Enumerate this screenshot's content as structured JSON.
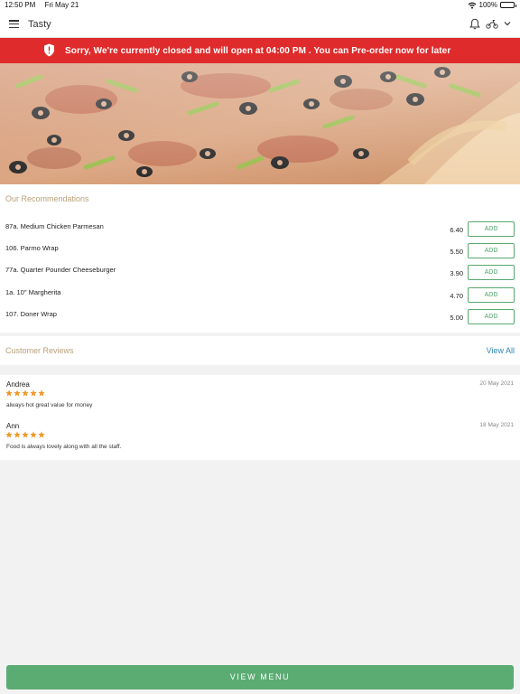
{
  "status_bar": {
    "time": "12:50 PM",
    "date": "Fri May 21",
    "battery": "100%"
  },
  "header": {
    "title": "Tasty"
  },
  "banner": {
    "message": "Sorry, We're currently closed and will open at 04:00 PM . You can Pre-order now for later",
    "color": "#df2b2b"
  },
  "recommendations": {
    "title": "Our Recommendations",
    "add_label": "ADD",
    "items": [
      {
        "name": "87a. Medium Chicken Parmesan",
        "price": "6.40"
      },
      {
        "name": "106. Parmo Wrap",
        "price": "5.50"
      },
      {
        "name": "77a. Quarter Pounder Cheeseburger",
        "price": "3.90"
      },
      {
        "name": "1a. 10\" Margherita",
        "price": "4.70"
      },
      {
        "name": "107. Doner Wrap",
        "price": "5.00"
      }
    ]
  },
  "reviews": {
    "title": "Customer Reviews",
    "view_all": "View All",
    "items": [
      {
        "name": "Andrea",
        "date": "20 May 2021",
        "rating": 5,
        "text": "always hot great value for money"
      },
      {
        "name": "Ann",
        "date": "18 May 2021",
        "rating": 5,
        "text": "Food is always lovely along with all the staff."
      }
    ]
  },
  "footer": {
    "button_label": "VIEW MENU",
    "color": "#5aac72"
  },
  "icons": [
    "menu-icon",
    "bell-icon",
    "scooter-icon",
    "chevron-down-icon",
    "shield-alert-icon",
    "wifi-icon",
    "battery-icon",
    "star-icon"
  ]
}
